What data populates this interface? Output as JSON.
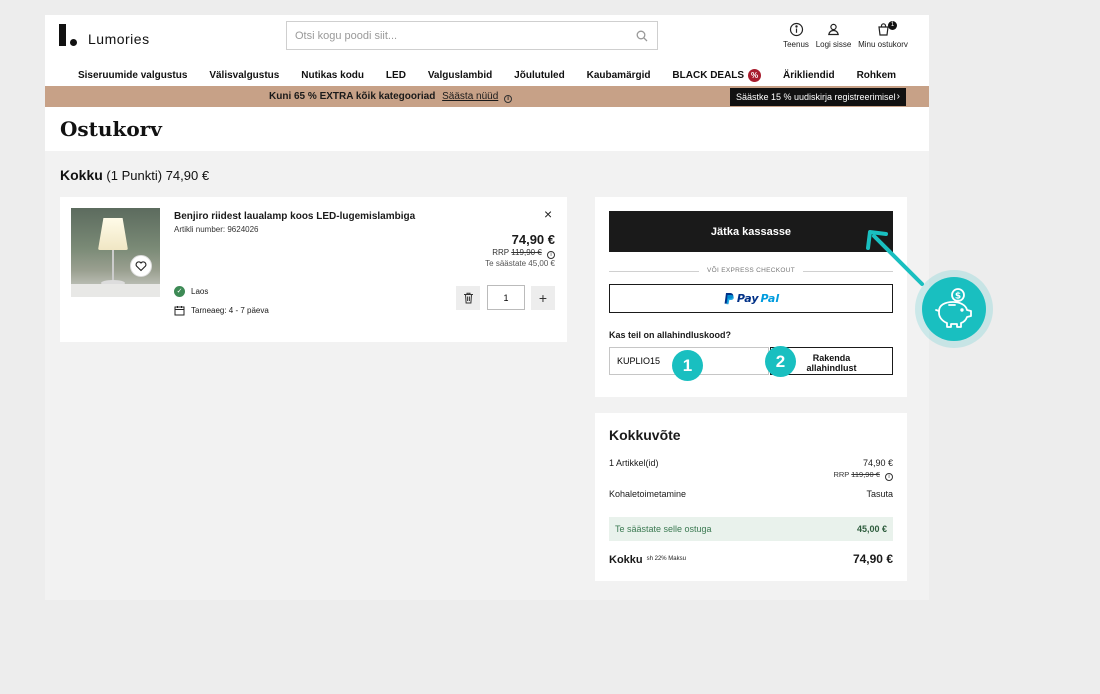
{
  "header": {
    "logo_text": "Lumories",
    "search_placeholder": "Otsi kogu poodi siit...",
    "icons": [
      {
        "label": "Teenus",
        "icon": "info-icon"
      },
      {
        "label": "Logi sisse",
        "icon": "user-icon"
      },
      {
        "label": "Minu ostukorv",
        "icon": "cart-icon",
        "badge": "1"
      }
    ]
  },
  "nav": {
    "items": [
      "Siseruumide valgustus",
      "Välisvalgustus",
      "Nutikas kodu",
      "LED",
      "Valguslambid",
      "Jõulutuled",
      "Kaubamärgid",
      "BLACK DEALS",
      "Ärikliendid",
      "Rohkem"
    ],
    "black_deals_badge": "%"
  },
  "promo": {
    "text": "Kuni 65 % EXTRA kõik kategooriad",
    "link": "Säästa nüüd",
    "pill": "Säästke 15 % uudiskirja registreerimisel",
    "pill_arrow": "›",
    "bg_color": "#c7a187"
  },
  "page": {
    "title": "Ostukorv",
    "total_label": "Kokku",
    "total_count": "(1 Punkti)",
    "total_value": "74,90 €"
  },
  "cart_item": {
    "name": "Benjiro riidest laualamp koos LED-lugemislambiga",
    "sku": "Artikli number: 9624026",
    "price": "74,90 €",
    "rrp_label": "RRP",
    "rrp_value": "119,90 €",
    "savings": "Te säästate 45,00 €",
    "stock": "Laos",
    "delivery": "Tarneaeg: 4 - 7 päeva",
    "quantity": "1",
    "remove": "×",
    "plus": "+"
  },
  "checkout": {
    "button": "Jätka kassasse",
    "express_label": "VÕI EXPRESS CHECKOUT",
    "paypal_1": "Pay",
    "paypal_2": "Pal",
    "coupon_label": "Kas teil on allahindluskood?",
    "coupon_value": "KUPLIO15",
    "apply_line1": "Rakenda",
    "apply_line2": "allahindlust",
    "step1": "1",
    "step2": "2",
    "accent_color": "#19bfc0"
  },
  "summary": {
    "title": "Kokkuvõte",
    "items_label": "1 Artikkel(id)",
    "items_value": "74,90 €",
    "rrp_label": "RRP",
    "rrp_value": "119,90 €",
    "shipping_label": "Kohaletoimetamine",
    "shipping_value": "Tasuta",
    "save_label": "Te säästate selle ostuga",
    "save_value": "45,00 €",
    "total_label": "Kokku",
    "tax_label": "sh 22% Maksu",
    "total_value": "74,90 €"
  }
}
